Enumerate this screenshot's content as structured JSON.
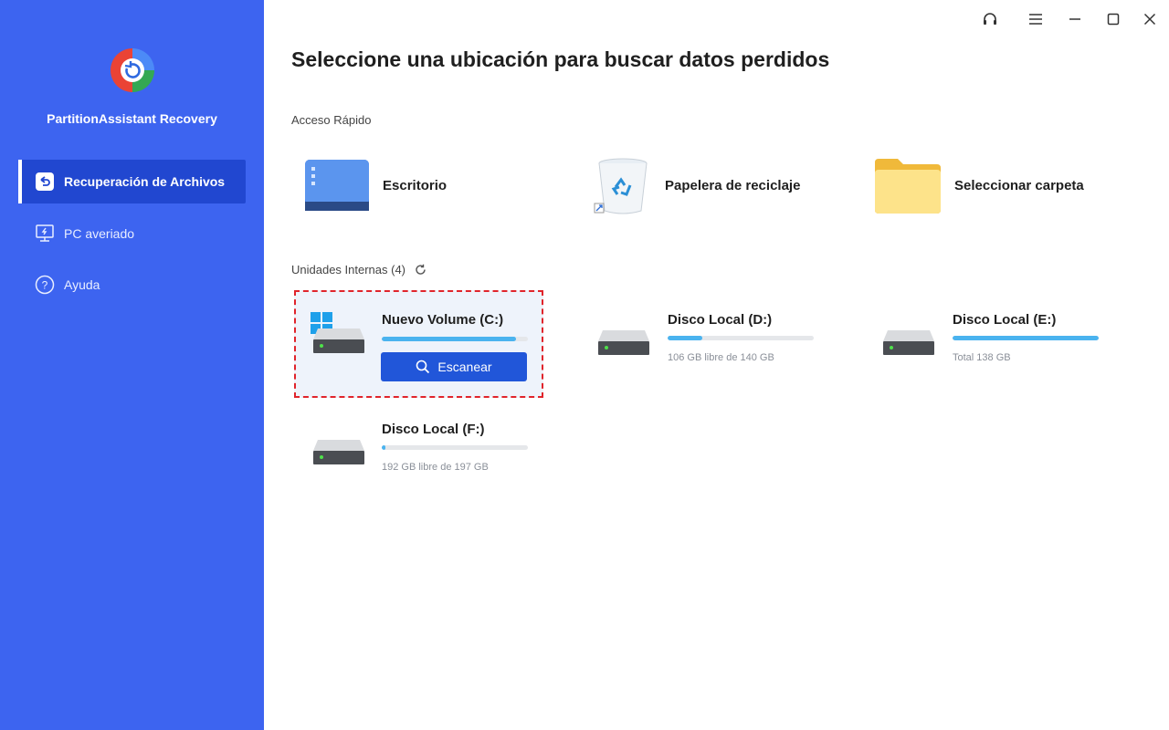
{
  "app": {
    "name": "PartitionAssistant Recovery"
  },
  "sidebar": {
    "items": [
      {
        "label": "Recuperación de Archivos",
        "icon": "file-recovery-icon",
        "active": true
      },
      {
        "label": "PC averiado",
        "icon": "broken-pc-icon",
        "active": false
      },
      {
        "label": "Ayuda",
        "icon": "help-icon",
        "active": false
      }
    ]
  },
  "titlebar": {
    "icons": [
      "headset-icon",
      "menu-icon",
      "minimize-icon",
      "maximize-icon",
      "close-icon"
    ]
  },
  "main": {
    "title": "Seleccione una ubicación para buscar datos perdidos",
    "quick_access": {
      "label": "Acceso Rápido",
      "items": [
        {
          "label": "Escritorio",
          "icon": "desktop-icon"
        },
        {
          "label": "Papelera de reciclaje",
          "icon": "recycle-bin-icon"
        },
        {
          "label": "Seleccionar carpeta",
          "icon": "folder-icon"
        }
      ]
    },
    "internal_drives": {
      "label": "Unidades Internas (4)",
      "drives": [
        {
          "name": "Nuevo Volume (C:)",
          "usage": 0.92,
          "selected": true,
          "system": true,
          "scan_label": "Escanear"
        },
        {
          "name": "Disco Local (D:)",
          "usage": 0.24,
          "info": "106 GB libre de 140 GB"
        },
        {
          "name": "Disco Local (E:)",
          "usage": 1.0,
          "info": "Total 138 GB"
        },
        {
          "name": "Disco Local (F:)",
          "usage": 0.025,
          "info": "192 GB libre de 197 GB"
        }
      ]
    }
  },
  "colors": {
    "sidebar": "#3d64f0",
    "sidebar_active": "#2147d0",
    "accent": "#2156d9",
    "bar_fill": "#4ab3ef",
    "selection_border": "#e0242b"
  }
}
